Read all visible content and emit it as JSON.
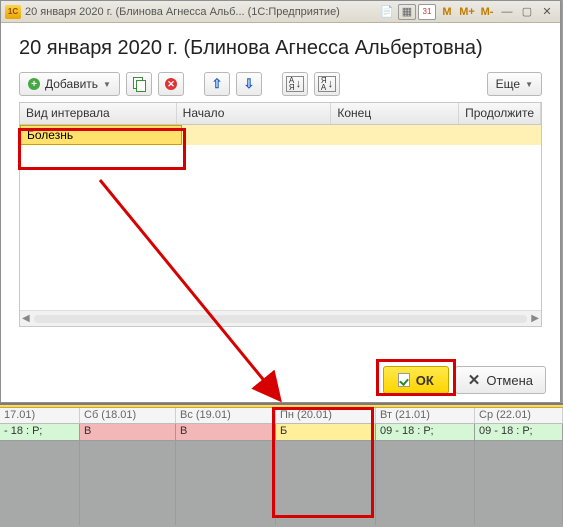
{
  "titlebar": {
    "logo_text": "1С",
    "title": "20 января 2020 г. (Блинова Агнесса Альб...  (1С:Предприятие)",
    "icons": {
      "m": "M",
      "mplus": "M+",
      "mminus": "M-",
      "cal31": "31"
    }
  },
  "heading": "20 января 2020 г. (Блинова Агнесса Альбертовна)",
  "toolbar": {
    "add_label": "Добавить",
    "more_label": "Еще"
  },
  "table": {
    "columns": [
      "Вид интервала",
      "Начало",
      "Конец",
      "Продолжите"
    ],
    "rows": [
      {
        "type": "Болезнь",
        "start": "",
        "end": "",
        "dur": ""
      }
    ]
  },
  "footer": {
    "ok_label": "ОК",
    "cancel_label": "Отмена"
  },
  "timeline": {
    "head": [
      "17.01)",
      "Сб (18.01)",
      "Вс (19.01)",
      "Пн (20.01)",
      "Вт (21.01)",
      "Ср (22.01)"
    ],
    "body": [
      {
        "tone": "work",
        "text": " - 18 : Р;"
      },
      {
        "tone": "absent",
        "text": "В"
      },
      {
        "tone": "absent",
        "text": "В"
      },
      {
        "tone": "sick",
        "text": "Б"
      },
      {
        "tone": "work",
        "text": "09 - 18 : Р;"
      },
      {
        "tone": "work",
        "text": "09 - 18 : Р;"
      }
    ]
  }
}
